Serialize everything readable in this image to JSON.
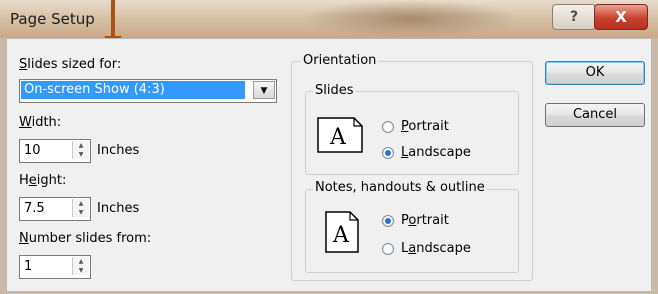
{
  "window": {
    "title": "Page Setup",
    "help_label": "?",
    "close_label": "X"
  },
  "slides_sized_for": {
    "label_accel": "S",
    "label_rest": "lides sized for:",
    "value": "On-screen Show (4:3)",
    "dropdown_icon": "chevron-down-icon"
  },
  "width": {
    "label_accel": "W",
    "label_rest": "idth:",
    "value": "10",
    "unit": "Inches"
  },
  "height": {
    "label_pre": "H",
    "label_accel": "e",
    "label_rest": "ight:",
    "value": "7.5",
    "unit": "Inches"
  },
  "number_slides_from": {
    "label_accel": "N",
    "label_rest": "umber slides from:",
    "value": "1"
  },
  "orientation": {
    "title": "Orientation",
    "slides": {
      "title": "Slides",
      "icon_letter": "A",
      "portrait_accel": "P",
      "portrait_rest": "ortrait",
      "landscape_accel": "L",
      "landscape_rest": "andscape",
      "selected": "landscape"
    },
    "notes": {
      "title": "Notes, handouts & outline",
      "icon_letter": "A",
      "portrait_pre": "P",
      "portrait_accel": "o",
      "portrait_rest": "rtrait",
      "landscape_pre": "L",
      "landscape_accel": "a",
      "landscape_rest": "ndscape",
      "selected": "portrait"
    }
  },
  "buttons": {
    "ok": "OK",
    "cancel": "Cancel"
  },
  "colors": {
    "selection": "#3399ff",
    "annotation_arrow": "#a85416",
    "radio_dot": "#2b6fd6"
  }
}
